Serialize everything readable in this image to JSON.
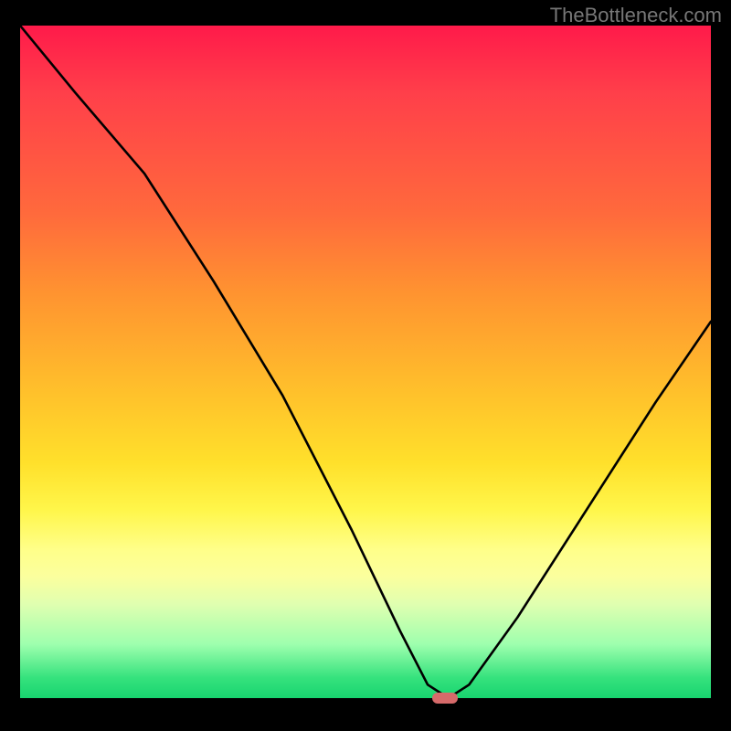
{
  "watermark": "TheBottleneck.com",
  "chart_data": {
    "type": "line",
    "title": "",
    "xlabel": "",
    "ylabel": "",
    "xlim": [
      0,
      100
    ],
    "ylim": [
      0,
      100
    ],
    "x": [
      0,
      8,
      18,
      28,
      38,
      48,
      55,
      59,
      62,
      65,
      72,
      82,
      92,
      100
    ],
    "values": [
      100,
      90,
      78,
      62,
      45,
      25,
      10,
      2,
      0,
      2,
      12,
      28,
      44,
      56
    ],
    "marker_x": 61.5,
    "marker_y": 0,
    "gradient_colors": {
      "top": "#ff1a4a",
      "mid": "#ffe02b",
      "bottom": "#18d46f"
    }
  }
}
